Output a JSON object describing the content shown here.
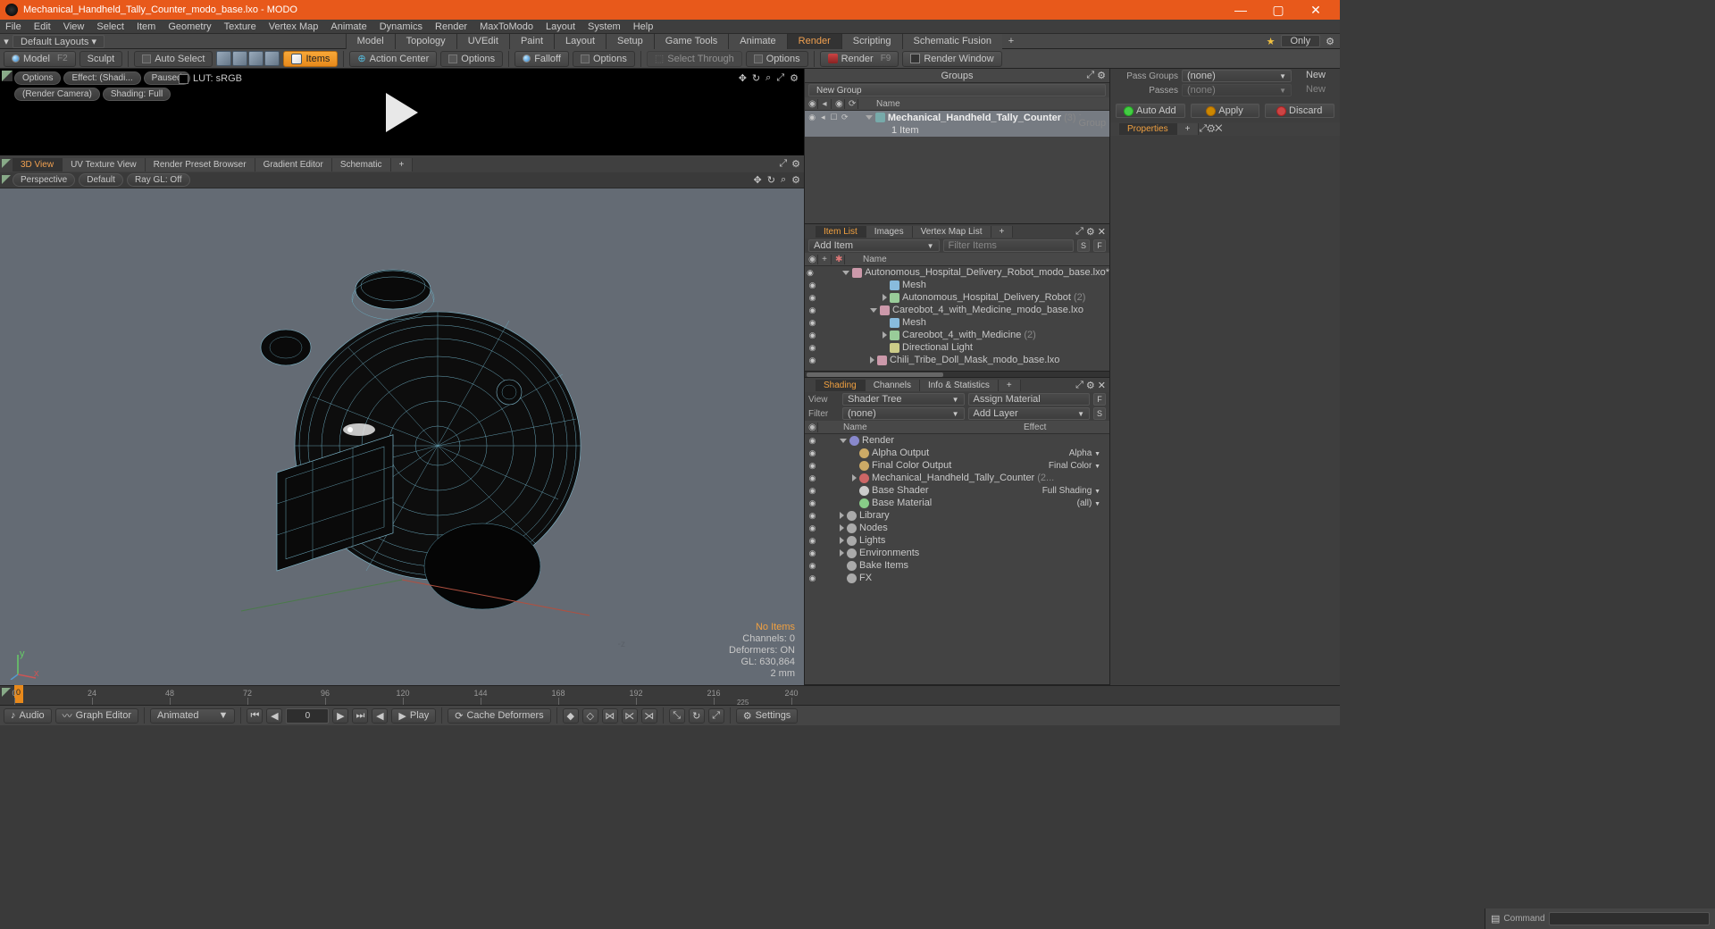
{
  "title": "Mechanical_Handheld_Tally_Counter_modo_base.lxo - MODO",
  "menubar": [
    "File",
    "Edit",
    "View",
    "Select",
    "Item",
    "Geometry",
    "Texture",
    "Vertex Map",
    "Animate",
    "Dynamics",
    "Render",
    "MaxToModo",
    "Layout",
    "System",
    "Help"
  ],
  "layout_selector": "Default Layouts ▾",
  "layout_tabs": [
    "Model",
    "Topology",
    "UVEdit",
    "Paint",
    "Layout",
    "Setup",
    "Game Tools",
    "Animate",
    "Render",
    "Scripting",
    "Schematic Fusion"
  ],
  "layout_active": "Render",
  "only_btn": "Only",
  "toolbar": {
    "model": "Model",
    "model_key": "F2",
    "sculpt": "Sculpt",
    "autoselect": "Auto Select",
    "items": "Items",
    "actioncenter": "Action Center",
    "options1": "Options",
    "falloff": "Falloff",
    "options2": "Options",
    "selectthrough": "Select Through",
    "options3": "Options",
    "render": "Render",
    "render_key": "F9",
    "renderwindow": "Render Window"
  },
  "preview": {
    "chips1": [
      "Options",
      "Effect: (Shadi...",
      "Paused"
    ],
    "chips2": [
      "(Render Camera)",
      "Shading: Full"
    ],
    "lut": "LUT: sRGB"
  },
  "view_tabs": [
    "3D View",
    "UV Texture View",
    "Render Preset Browser",
    "Gradient Editor",
    "Schematic"
  ],
  "view_tabs_active": "3D View",
  "subbar": {
    "persp": "Perspective",
    "default": "Default",
    "raygl": "Ray GL: Off"
  },
  "viewport_info": {
    "noitems": "No Items",
    "channels": "Channels: 0",
    "deformers": "Deformers: ON",
    "gl": "GL: 630,864",
    "scale": "2 mm"
  },
  "groups": {
    "title": "Groups",
    "newgroup": "New Group",
    "name_col": "Name",
    "row": {
      "name": "Mechanical_Handheld_Tally_Counter",
      "count": "(3)",
      "type": ": Group",
      "sub": "1 Item"
    }
  },
  "itemlist": {
    "tabs": [
      "Item List",
      "Images",
      "Vertex Map List"
    ],
    "active": "Item List",
    "additem": "Add Item",
    "filter": "Filter Items",
    "name_col": "Name",
    "rows": [
      {
        "ind": 1,
        "icon": "scene",
        "name": "Autonomous_Hospital_Delivery_Robot_modo_base.lxo*",
        "count": "",
        "open": true
      },
      {
        "ind": 2,
        "icon": "mesh",
        "name": "Mesh",
        "count": ""
      },
      {
        "ind": 2,
        "icon": "loc",
        "name": "Autonomous_Hospital_Delivery_Robot",
        "count": "(2)",
        "closed": true
      },
      {
        "ind": 1,
        "icon": "scene",
        "name": "Careobot_4_with_Medicine_modo_base.lxo",
        "count": "",
        "open": true
      },
      {
        "ind": 2,
        "icon": "mesh",
        "name": "Mesh",
        "count": ""
      },
      {
        "ind": 2,
        "icon": "loc",
        "name": "Careobot_4_with_Medicine",
        "count": "(2)",
        "closed": true
      },
      {
        "ind": 2,
        "icon": "light",
        "name": "Directional Light",
        "count": ""
      },
      {
        "ind": 1,
        "icon": "scene",
        "name": "Chili_Tribe_Doll_Mask_modo_base.lxo",
        "count": "",
        "closed": true
      }
    ]
  },
  "shading": {
    "tabs": [
      "Shading",
      "Channels",
      "Info & Statistics"
    ],
    "active": "Shading",
    "view_lbl": "View",
    "view_val": "Shader Tree",
    "assign": "Assign Material",
    "filter_lbl": "Filter",
    "filter_val": "(none)",
    "addlayer": "Add Layer",
    "cols": {
      "name": "Name",
      "effect": "Effect"
    },
    "rows": [
      {
        "ind": 1,
        "icon": "render",
        "name": "Render",
        "effect": "",
        "open": true
      },
      {
        "ind": 2,
        "icon": "out",
        "name": "Alpha Output",
        "effect": "Alpha"
      },
      {
        "ind": 2,
        "icon": "out",
        "name": "Final Color Output",
        "effect": "Final Color"
      },
      {
        "ind": 2,
        "icon": "mat",
        "name": "Mechanical_Handheld_Tally_Counter",
        "count": "(2...",
        "effect": "",
        "closed": true
      },
      {
        "ind": 2,
        "icon": "shader",
        "name": "Base Shader",
        "effect": "Full Shading"
      },
      {
        "ind": 2,
        "icon": "matb",
        "name": "Base Material",
        "effect": "(all)"
      },
      {
        "ind": 1,
        "icon": "lib",
        "name": "Library",
        "effect": "",
        "closed": true
      },
      {
        "ind": 1,
        "icon": "nodes",
        "name": "Nodes",
        "effect": "",
        "closed": true
      },
      {
        "ind": 1,
        "icon": "lights",
        "name": "Lights",
        "effect": "",
        "closed": true
      },
      {
        "ind": 1,
        "icon": "env",
        "name": "Environments",
        "effect": "",
        "closed": true
      },
      {
        "ind": 1,
        "icon": "bake",
        "name": "Bake Items",
        "effect": ""
      },
      {
        "ind": 1,
        "icon": "fx",
        "name": "FX",
        "effect": ""
      }
    ]
  },
  "passes": {
    "passgroups_lbl": "Pass Groups",
    "passgroups_val": "(none)",
    "new": "New",
    "passes_lbl": "Passes",
    "passes_val": "(none)",
    "new2": "New"
  },
  "actions": {
    "autoadd": "Auto Add",
    "apply": "Apply",
    "discard": "Discard"
  },
  "properties_tab": "Properties",
  "timeline": {
    "ticks": [
      0,
      24,
      48,
      72,
      96,
      120,
      144,
      168,
      192,
      216,
      240
    ],
    "sub": "225"
  },
  "bottombar": {
    "audio": "Audio",
    "graph": "Graph Editor",
    "animated": "Animated",
    "frame": "0",
    "play": "Play",
    "cache": "Cache Deformers",
    "settings": "Settings"
  },
  "command_lbl": "Command"
}
